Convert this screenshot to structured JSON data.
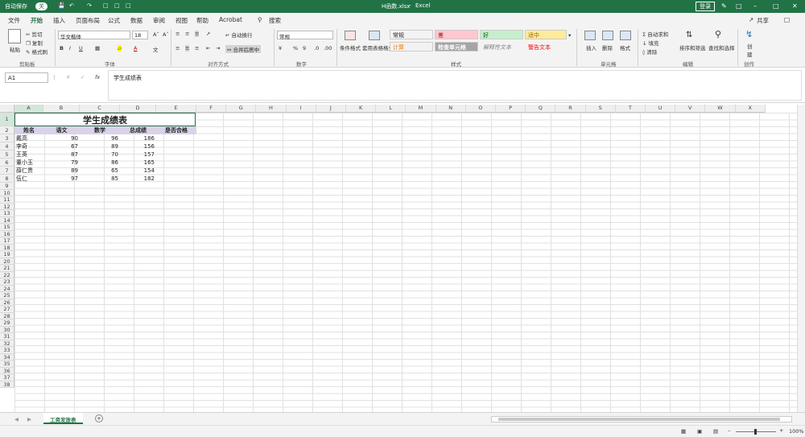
{
  "titlebar": {
    "autosave_label": "自动保存",
    "autosave_state": "关",
    "filename": "H函数.xlsx",
    "sep": "-",
    "app": "Excel",
    "login_label": "登录",
    "accent_color": "#217346"
  },
  "menu": {
    "items": [
      "文件",
      "开始",
      "插入",
      "页面布局",
      "公式",
      "数据",
      "审阅",
      "视图",
      "帮助",
      "Acrobat"
    ],
    "active": "开始",
    "search_label": "搜索",
    "share_label": "共享"
  },
  "ribbon": {
    "clipboard": {
      "paste": "粘贴",
      "cut": "剪切",
      "copy": "复制",
      "format_painter": "格式刷",
      "label": "剪贴板"
    },
    "font": {
      "name": "华文楷体",
      "size": "18",
      "label": "字体"
    },
    "alignment": {
      "wrap": "自动换行",
      "merge": "合并后居中",
      "label": "对齐方式"
    },
    "number": {
      "format": "常规",
      "label": "数字"
    },
    "styles": {
      "conditional": "条件格式",
      "table": "套用表格格式",
      "cells": [
        {
          "text": "常规",
          "bg": "#ffffff",
          "fg": "#000000"
        },
        {
          "text": "差",
          "bg": "#ffc7ce",
          "fg": "#9c0006"
        },
        {
          "text": "好",
          "bg": "#c6efce",
          "fg": "#006100"
        },
        {
          "text": "适中",
          "bg": "#ffeb9c",
          "fg": "#9c6500"
        },
        {
          "text": "计算",
          "bg": "#f2f2f2",
          "fg": "#fa7d00"
        },
        {
          "text": "检查单元格",
          "bg": "#a5a5a5",
          "fg": "#ffffff"
        },
        {
          "text": "解释性文本",
          "bg": "#ffffff",
          "fg": "#7f7f7f"
        },
        {
          "text": "警告文本",
          "bg": "#ffffff",
          "fg": "#ff0000"
        }
      ],
      "label": "样式"
    },
    "cells_group": {
      "insert": "插入",
      "delete": "删除",
      "format": "格式",
      "label": "单元格"
    },
    "editing": {
      "autosum": "自动求和",
      "fill": "填充",
      "clear": "清除",
      "sort": "排序和筛选",
      "find": "查找和选择",
      "label": "编辑"
    },
    "create": {
      "btn": "创建",
      "label": "创作"
    }
  },
  "formula_bar": {
    "name_box": "A1",
    "fx": "fx",
    "content": "学生成绩表"
  },
  "columns": [
    "A",
    "B",
    "C",
    "D",
    "E",
    "F",
    "G",
    "H",
    "I",
    "J",
    "K",
    "L",
    "M",
    "N",
    "O",
    "P",
    "Q",
    "R",
    "S",
    "T",
    "U",
    "V",
    "W",
    "X"
  ],
  "sheet": {
    "title": "学生成绩表",
    "headers": [
      "姓名",
      "语文",
      "数学",
      "总成绩",
      "是否合格"
    ],
    "rows": [
      [
        "戴高",
        "90",
        "96",
        "186",
        ""
      ],
      [
        "李奇",
        "67",
        "89",
        "156",
        ""
      ],
      [
        "王英",
        "87",
        "70",
        "157",
        ""
      ],
      [
        "董小玉",
        "79",
        "86",
        "165",
        ""
      ],
      [
        "薛仁贵",
        "89",
        "65",
        "154",
        ""
      ],
      [
        "伍仁",
        "97",
        "85",
        "182",
        ""
      ]
    ],
    "row_count": 38
  },
  "tabs": {
    "active_tab": "工资发放表",
    "add_label": "+"
  },
  "status": {
    "zoom": "100%"
  }
}
